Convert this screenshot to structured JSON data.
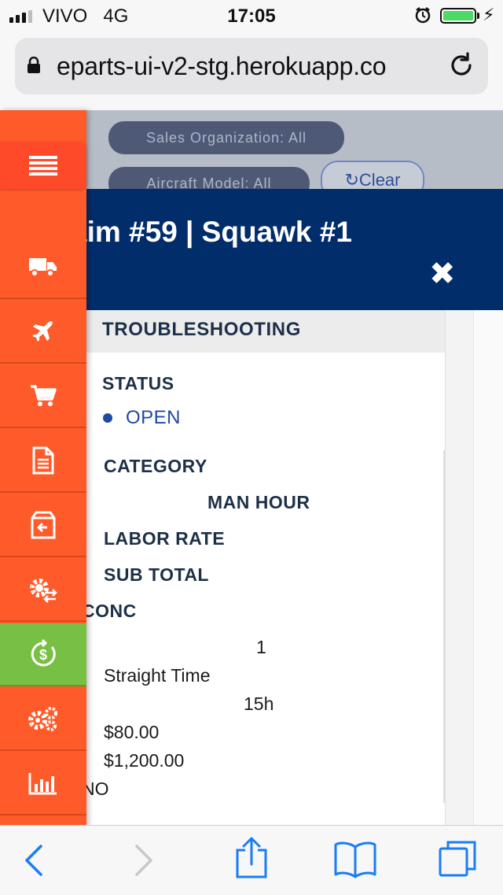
{
  "status_bar": {
    "carrier": "VIVO",
    "network": "4G",
    "time": "17:05",
    "battery_level": 1.0
  },
  "browser": {
    "url": "eparts-ui-v2-stg.herokuapp.co"
  },
  "filters": {
    "sales_organization": "Sales Organization: All",
    "aircraft_model": "Aircraft Model: All",
    "clear_label": "Clear"
  },
  "modal": {
    "title": "aim #59 | Squawk #1",
    "section_title": "TROUBLESHOOTING",
    "status_label": "STATUS",
    "status_value": "OPEN",
    "category_label": "CATEGORY",
    "man_hour_label": "MAN HOUR",
    "labor_rate_label": "LABOR RATE",
    "sub_total_label": "SUB TOTAL",
    "conc_label": "CONC",
    "category_index": "1",
    "category_value": "Straight Time",
    "man_hour_value": "15h",
    "labor_rate_value": "$80.00",
    "sub_total_value": "$1,200.00",
    "conc_value": "NO"
  },
  "sidenav": {
    "items": [
      {
        "icon": "truck-icon"
      },
      {
        "icon": "airplane-icon"
      },
      {
        "icon": "cart-icon"
      },
      {
        "icon": "document-icon"
      },
      {
        "icon": "box-return-icon"
      },
      {
        "icon": "gear-exchange-icon"
      },
      {
        "icon": "dollar-refresh-icon",
        "active": true
      },
      {
        "icon": "gears-icon"
      },
      {
        "icon": "bar-chart-icon"
      }
    ]
  },
  "colors": {
    "nav_orange": "#ff5a2a",
    "nav_active_green": "#77c043",
    "modal_header_navy": "#022d6b",
    "ios_blue": "#1a7cf5",
    "status_blue": "#1f4aa3"
  }
}
